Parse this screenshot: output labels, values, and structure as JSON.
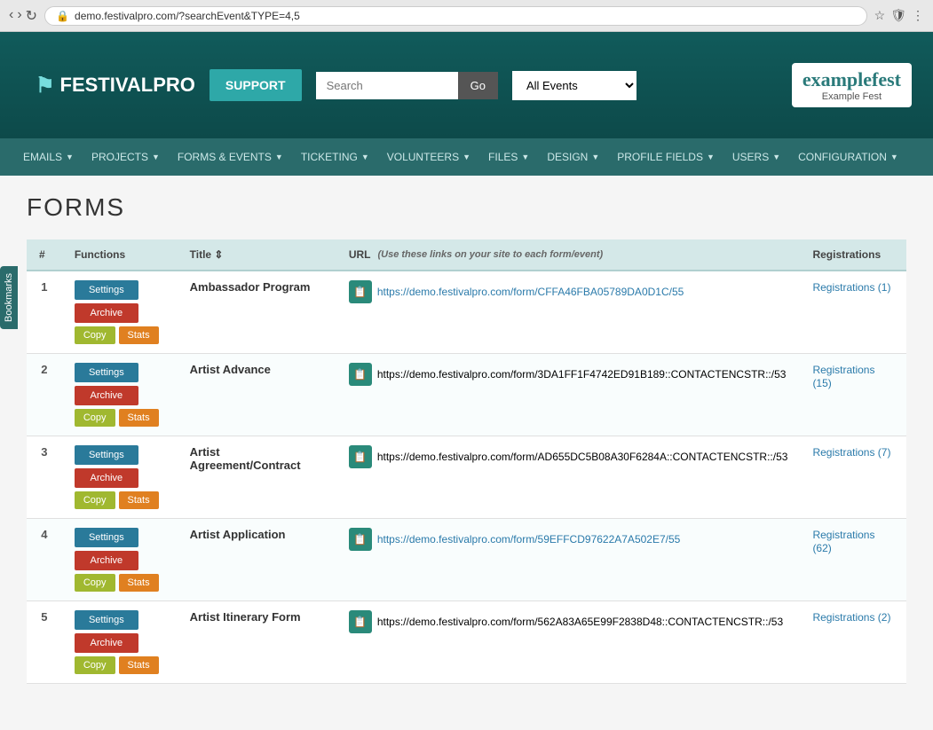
{
  "browser": {
    "url": "demo.festivalpro.com/?searchEvent&TYPE=4,5"
  },
  "header": {
    "logo_text": "FESTIVALPRO",
    "support_label": "SUPPORT",
    "search_placeholder": "Search",
    "go_label": "Go",
    "events_dropdown": "All Events",
    "brand_logo_text": "examplefest",
    "brand_sub": "Example Fest"
  },
  "nav": {
    "items": [
      {
        "label": "EMAILS",
        "id": "emails"
      },
      {
        "label": "PROJECTS",
        "id": "projects"
      },
      {
        "label": "FORMS & EVENTS",
        "id": "forms-events"
      },
      {
        "label": "TICKETING",
        "id": "ticketing"
      },
      {
        "label": "VOLUNTEERS",
        "id": "volunteers"
      },
      {
        "label": "FILES",
        "id": "files"
      },
      {
        "label": "DESIGN",
        "id": "design"
      },
      {
        "label": "PROFILE FIELDS",
        "id": "profile-fields"
      },
      {
        "label": "USERS",
        "id": "users"
      },
      {
        "label": "CONFIGURATION",
        "id": "configuration"
      }
    ]
  },
  "page": {
    "title": "FORMS",
    "table": {
      "columns": [
        "#",
        "Functions",
        "Title",
        "URL",
        "Registrations"
      ],
      "url_note": "(Use these links on your site to each form/event)",
      "rows": [
        {
          "num": "1",
          "title": "Ambassador Program",
          "url": "https://demo.festivalpro.com/form/CFFA46FBA05789DA0D1C/55",
          "url_full": "https://demo.festivalpro.com/form/CFFA46FBA05789DA0D1C/55",
          "registrations": "Registrations (1)",
          "has_link": true
        },
        {
          "num": "2",
          "title": "Artist Advance",
          "url": "https://demo.festivalpro.com/form/3DA1FF1F4742ED91B189::CONTACTENCSTR::/53",
          "url_full": "https://demo.festivalpro.com/form/3DA1FF1F4742ED91B189::CONTACTENCSTR::/53",
          "registrations": "Registrations (15)",
          "has_link": false
        },
        {
          "num": "3",
          "title": "Artist Agreement/Contract",
          "url": "https://demo.festivalpro.com/form/AD655DC5B08A30F6284A::CONTACTENCSTR::/53",
          "url_full": "https://demo.festivalpro.com/form/AD655DC5B08A30F6284A::CONTACTENCSTR::/53",
          "registrations": "Registrations (7)",
          "has_link": false
        },
        {
          "num": "4",
          "title": "Artist Application",
          "url": "https://demo.festivalpro.com/form/59EFFCD97622A7A502E7/55",
          "url_full": "https://demo.festivalpro.com/form/59EFFCD97622A7A502E7/55",
          "registrations": "Registrations (62)",
          "has_link": true
        },
        {
          "num": "5",
          "title": "Artist Itinerary Form",
          "url": "https://demo.festivalpro.com/form/562A83A65E99F2838D48::CONTACTENCSTR::/53",
          "url_full": "https://demo.festivalpro.com/form/562A83A65E99F2838D48::CONTACTENCSTR::/53",
          "registrations": "Registrations (2)",
          "has_link": false
        }
      ],
      "btn_settings": "Settings",
      "btn_archive": "Archive",
      "btn_copy": "Copy",
      "btn_stats": "Stats"
    }
  },
  "bookmarks": {
    "label": "Bookmarks"
  }
}
